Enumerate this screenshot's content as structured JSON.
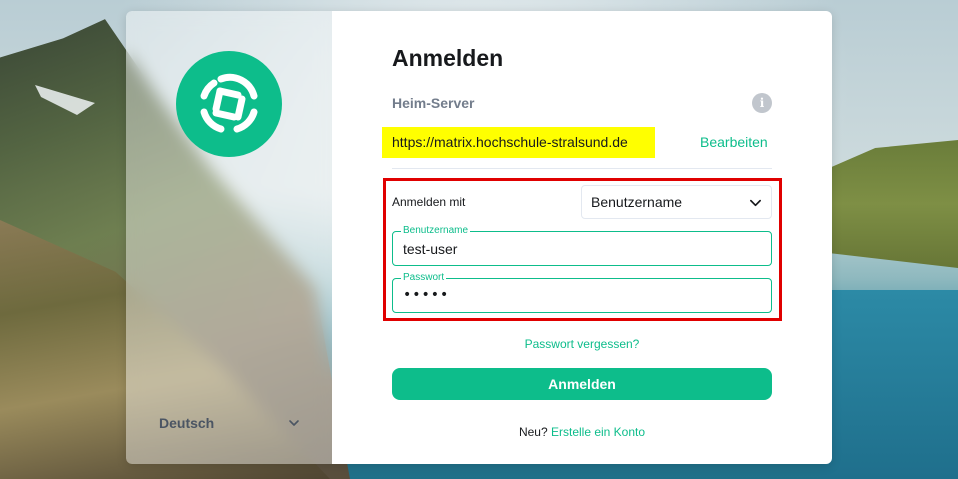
{
  "auth": {
    "title": "Anmelden",
    "homeserver_label": "Heim-Server",
    "homeserver_url": "https://matrix.hochschule-stralsund.de",
    "edit_label": "Bearbeiten",
    "login_with_label": "Anmelden mit",
    "login_with_value": "Benutzername",
    "username_label": "Benutzername",
    "username_value": "test-user",
    "password_label": "Passwort",
    "password_value": "•••••",
    "forgot_password": "Passwort vergessen?",
    "submit_label": "Anmelden",
    "signup_prefix": "Neu?",
    "signup_link": "Erstelle ein Konto"
  },
  "side": {
    "language": "Deutsch",
    "logo_icon": "element-logo-icon"
  },
  "icons": {
    "info": "info-icon",
    "dropdown": "chevron-down-icon"
  },
  "colors": {
    "accent": "#0dbd8b",
    "highlight": "#ffff00",
    "annotation_box": "#e00000"
  }
}
